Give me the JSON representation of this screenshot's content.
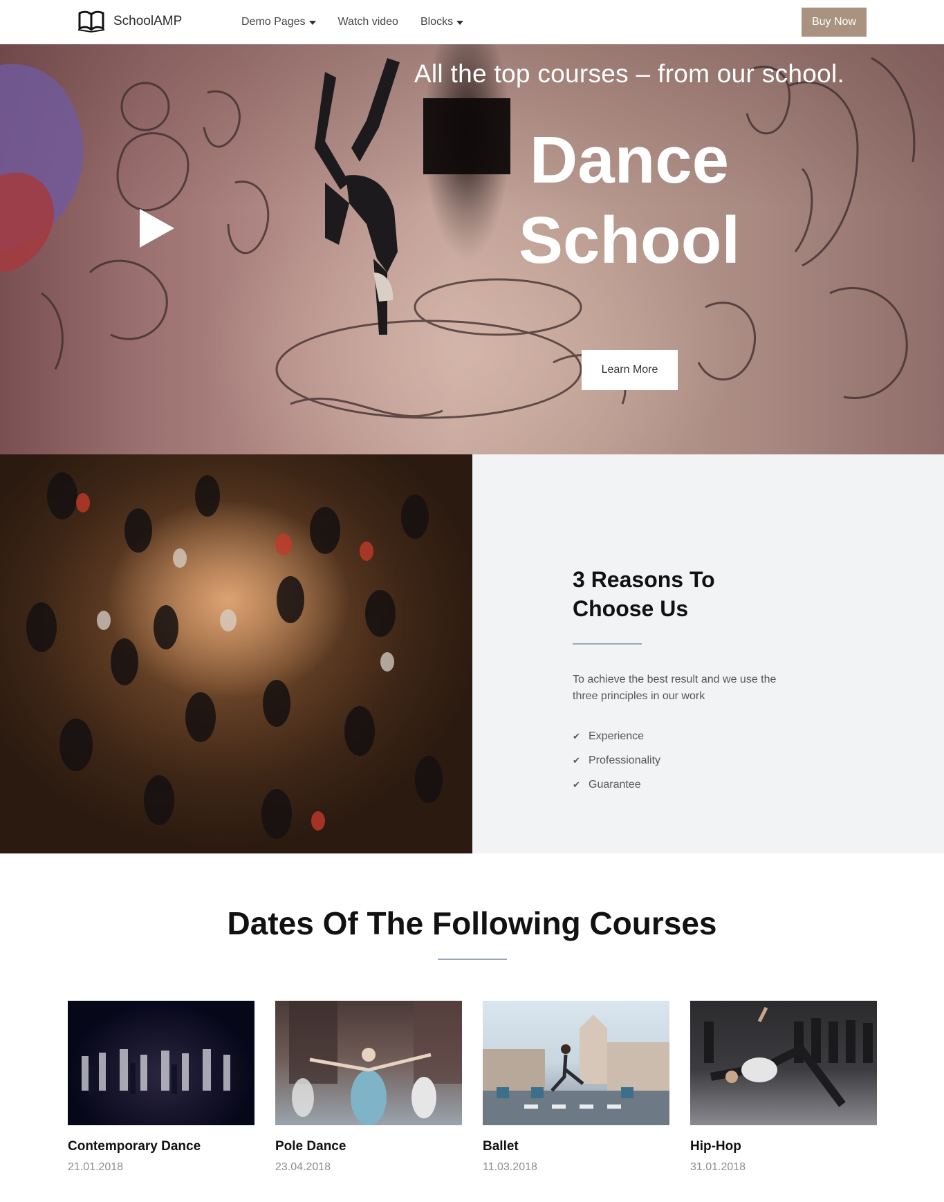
{
  "nav": {
    "brand": "SchoolAMP",
    "items": [
      {
        "label": "Demo Pages",
        "dropdown": true
      },
      {
        "label": "Watch video",
        "dropdown": false
      },
      {
        "label": "Blocks",
        "dropdown": true
      }
    ],
    "buy_label": "Buy Now",
    "buy_color": "#a99380"
  },
  "hero": {
    "tagline": "All the top courses – from our school.",
    "title_line1": "Dance",
    "title_line2": "School",
    "cta_label": "Learn More",
    "play_icon": "play-icon"
  },
  "reasons": {
    "title_line1": "3 Reasons To",
    "title_line2": "Choose Us",
    "description": "To achieve the best result and we use the three principles in our work",
    "items": [
      "Experience",
      "Professionality",
      "Guarantee"
    ],
    "bullet_icon": "check-icon"
  },
  "courses": {
    "title": "Dates Of The Following Courses",
    "cards": [
      {
        "name": "Contemporary Dance",
        "date": "21.01.2018"
      },
      {
        "name": "Pole Dance",
        "date": "23.04.2018"
      },
      {
        "name": "Ballet",
        "date": "11.03.2018"
      },
      {
        "name": "Hip-Hop",
        "date": "31.01.2018"
      }
    ]
  }
}
